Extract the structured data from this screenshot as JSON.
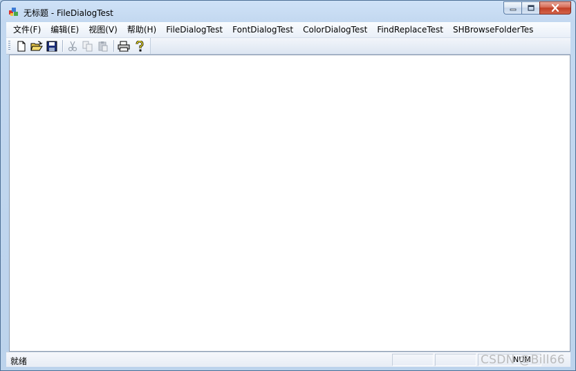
{
  "window": {
    "title": "无标题 - FileDialogTest"
  },
  "menubar": {
    "items": [
      {
        "label": "文件(F)"
      },
      {
        "label": "编辑(E)"
      },
      {
        "label": "视图(V)"
      },
      {
        "label": "帮助(H)"
      },
      {
        "label": "FileDialogTest"
      },
      {
        "label": "FontDialogTest"
      },
      {
        "label": "ColorDialogTest"
      },
      {
        "label": "FindReplaceTest"
      },
      {
        "label": "SHBrowseFolderTes"
      }
    ]
  },
  "toolbar": {
    "buttons": [
      "new-icon",
      "open-icon",
      "save-icon",
      "cut-icon",
      "copy-icon",
      "paste-icon",
      "print-icon",
      "help-icon"
    ]
  },
  "statusbar": {
    "text": "就绪",
    "indicator": "NUM"
  },
  "watermark": {
    "text": "CSDN @Bill66"
  },
  "colors": {
    "frame": "#bcd3ec",
    "close_button": "#c13f26"
  }
}
